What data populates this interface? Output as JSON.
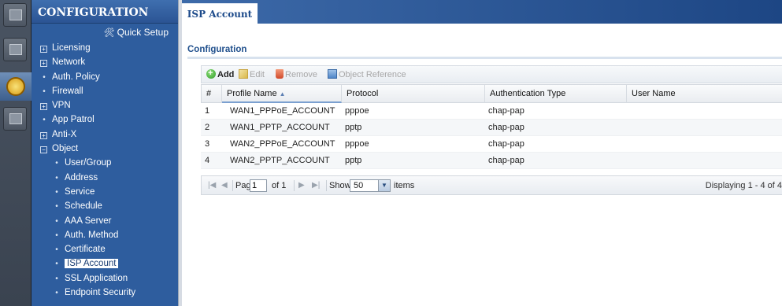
{
  "nav": {
    "title": "CONFIGURATION",
    "quick_setup": "Quick Setup",
    "items": [
      {
        "label": "Licensing",
        "marker": "+"
      },
      {
        "label": "Network",
        "marker": "+"
      },
      {
        "label": "Auth. Policy",
        "marker": "•"
      },
      {
        "label": "Firewall",
        "marker": "•"
      },
      {
        "label": "VPN",
        "marker": "+"
      },
      {
        "label": "App Patrol",
        "marker": "•"
      },
      {
        "label": "Anti-X",
        "marker": "+"
      },
      {
        "label": "Object",
        "marker": "−"
      },
      {
        "label": "User/Group",
        "marker": "•"
      },
      {
        "label": "Address",
        "marker": "•"
      },
      {
        "label": "Service",
        "marker": "•"
      },
      {
        "label": "Schedule",
        "marker": "•"
      },
      {
        "label": "AAA Server",
        "marker": "•"
      },
      {
        "label": "Auth. Method",
        "marker": "•"
      },
      {
        "label": "Certificate",
        "marker": "•"
      },
      {
        "label": "ISP Account",
        "marker": "•"
      },
      {
        "label": "SSL Application",
        "marker": "•"
      },
      {
        "label": "Endpoint Security",
        "marker": "•"
      }
    ]
  },
  "tab": {
    "label": "ISP Account"
  },
  "section": {
    "title": "Configuration"
  },
  "toolbar": {
    "add": "Add",
    "edit": "Edit",
    "remove": "Remove",
    "object_reference": "Object Reference"
  },
  "grid": {
    "columns": [
      "#",
      "Profile Name",
      "Protocol",
      "Authentication Type",
      "User Name"
    ],
    "sorted_column": "Profile Name",
    "rows": [
      [
        "1",
        "WAN1_PPPoE_ACCOUNT",
        "pppoe",
        "chap-pap",
        ""
      ],
      [
        "2",
        "WAN1_PPTP_ACCOUNT",
        "pptp",
        "chap-pap",
        ""
      ],
      [
        "3",
        "WAN2_PPPoE_ACCOUNT",
        "pppoe",
        "chap-pap",
        ""
      ],
      [
        "4",
        "WAN2_PPTP_ACCOUNT",
        "pptp",
        "chap-pap",
        ""
      ]
    ]
  },
  "pager": {
    "page_label": "Page",
    "page_value": "1",
    "of_label": "of 1",
    "show_label": "Show",
    "show_value": "50",
    "items_label": "items",
    "status": "Displaying 1 - 4 of 4"
  },
  "colors": {
    "nav_bg": "#2e5d9e",
    "accent": "#1f4f8c"
  }
}
